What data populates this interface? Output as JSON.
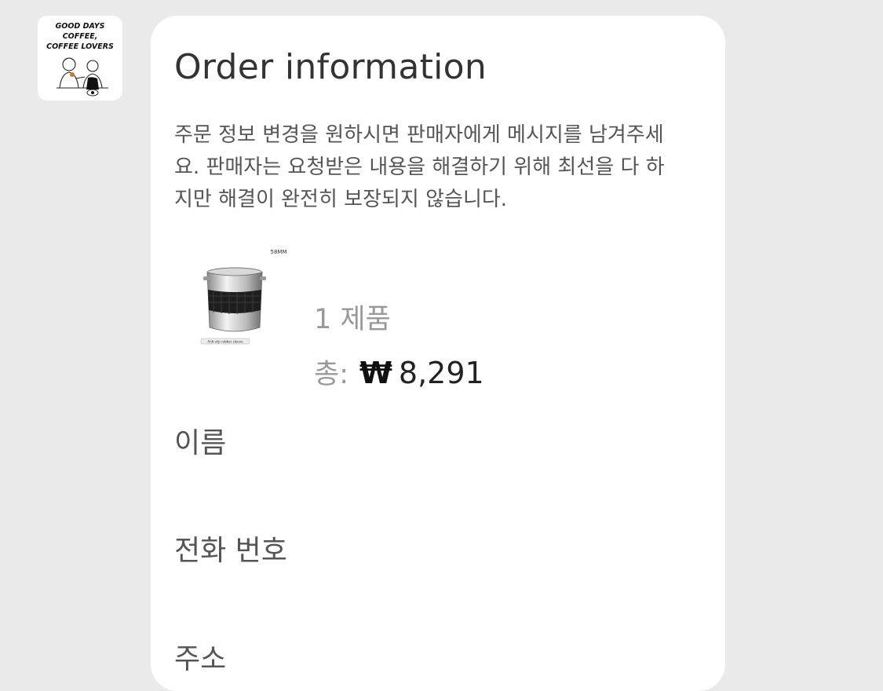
{
  "seller": {
    "logo_icon": "coffee-shop-logo-icon",
    "logo_text": [
      "GOOD DAYS",
      "COFFEE,",
      "COFFEE LOVERS"
    ]
  },
  "order": {
    "title": "Order information",
    "description": "주문 정보 변경을 원하시면 판매자에게 메시지를 남겨주세요. 판매자는 요청받은 내용을 해결하기 위해 최선을 다 하지만 해결이 완전히 보장되지 않습니다.",
    "product": {
      "image_icon": "coffee-dosing-ring-product-icon",
      "image_badge": "58MM",
      "image_caption": "Anti-slip rubber sleeve",
      "count_label": "1 제품"
    },
    "total": {
      "label": "총:",
      "currency": "₩",
      "amount": "8,291"
    },
    "fields": {
      "name_label": "이름",
      "phone_label": "전화 번호",
      "address_label": "주소"
    }
  },
  "colors": {
    "background": "#eaeaea",
    "card": "#ffffff",
    "muted_text": "#999999",
    "body_text": "#555555"
  }
}
